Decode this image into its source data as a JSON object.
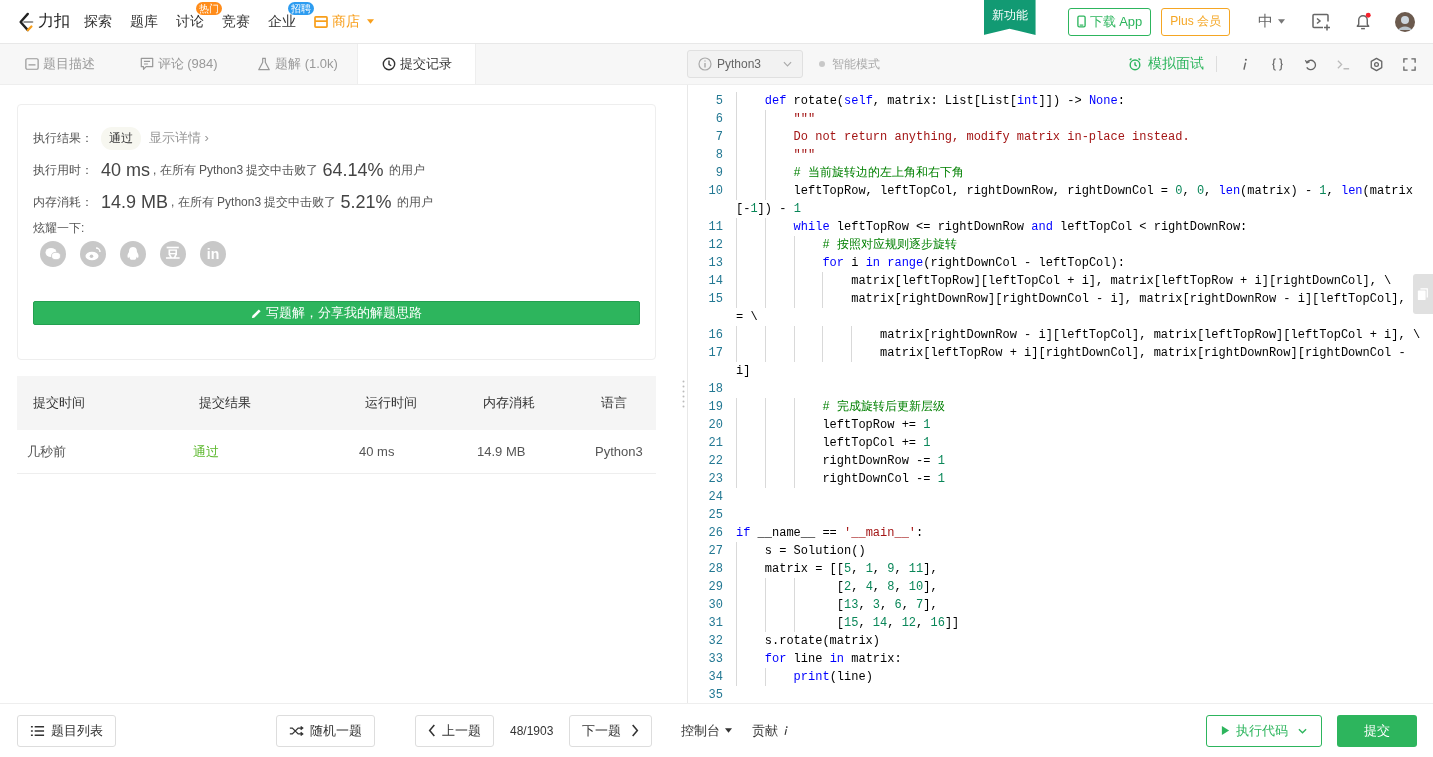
{
  "nav": {
    "brand": "力扣",
    "items": [
      {
        "kind": "link",
        "label": "探索"
      },
      {
        "kind": "link",
        "label": "题库"
      },
      {
        "kind": "link",
        "label": "讨论",
        "badge": {
          "text": "热门",
          "color": "#ff8c1a"
        }
      },
      {
        "kind": "link",
        "label": "竞赛"
      },
      {
        "kind": "link",
        "label": "企业",
        "badge": {
          "text": "招聘",
          "color": "#2d9cf0"
        }
      },
      {
        "kind": "store",
        "label": "商店"
      }
    ],
    "new_feature": "新功能",
    "download": "下载 App",
    "plus": "Plus 会员",
    "language": "中",
    "has_notification": true
  },
  "tabs": [
    {
      "kind": "description",
      "label": "题目描述",
      "selected": false
    },
    {
      "kind": "comments",
      "label": "评论 (984)",
      "selected": false
    },
    {
      "kind": "solutions",
      "label": "题解 (1.0k)",
      "selected": false
    },
    {
      "kind": "submissions",
      "label": "提交记录",
      "selected": true
    }
  ],
  "result": {
    "label": "执行结果：",
    "status": "通过",
    "details_link": "显示详情 ›"
  },
  "stats": [
    {
      "label": "执行用时：",
      "value": "40 ms",
      "text": ", 在所有 Python3 提交中击败了",
      "percent": "64.14%",
      "suffix": "的用户"
    },
    {
      "label": "内存消耗：",
      "value": "14.9 MB",
      "text": ", 在所有 Python3 提交中击败了",
      "percent": "5.21%",
      "suffix": "的用户"
    }
  ],
  "share": {
    "label": "炫耀一下:",
    "items": [
      {
        "kind": "wechat"
      },
      {
        "kind": "weibo"
      },
      {
        "kind": "qq"
      },
      {
        "kind": "glyph",
        "text": "豆"
      },
      {
        "kind": "glyph",
        "text": "in"
      }
    ]
  },
  "write_solution": "写题解，分享我的解题思路",
  "submissions": {
    "columns": [
      "提交时间",
      "提交结果",
      "运行时间",
      "内存消耗",
      "语言"
    ],
    "rows": [
      {
        "time": "几秒前",
        "result": "通过",
        "passed": true,
        "runtime": "40 ms",
        "memory": "14.9 MB",
        "language": "Python3"
      }
    ]
  },
  "editor": {
    "language": "Python3",
    "smart_mode": {
      "label": "智能模式",
      "on": false
    },
    "interview": "模拟面试",
    "lines": [
      {
        "number": "5",
        "tokens": [
          {
            "kind": "keyword",
            "text": "    def"
          },
          {
            "kind": "plain",
            "text": " rotate("
          },
          {
            "kind": "keyword",
            "text": "self"
          },
          {
            "kind": "plain",
            "text": ", matrix: List[List["
          },
          {
            "kind": "keyword",
            "text": "int"
          },
          {
            "kind": "plain",
            "text": "]]) -> "
          },
          {
            "kind": "keyword",
            "text": "None"
          },
          {
            "kind": "plain",
            "text": ":"
          }
        ]
      },
      {
        "number": "6",
        "tokens": [
          {
            "kind": "string",
            "text": "        \"\"\""
          }
        ]
      },
      {
        "number": "7",
        "tokens": [
          {
            "kind": "string",
            "text": "        Do not return anything, modify matrix in-place instead."
          }
        ]
      },
      {
        "number": "8",
        "tokens": [
          {
            "kind": "string",
            "text": "        \"\"\""
          }
        ]
      },
      {
        "number": "9",
        "tokens": [
          {
            "kind": "comment",
            "text": "        # 当前旋转边的左上角和右下角"
          }
        ]
      },
      {
        "number": "10",
        "tokens": [
          {
            "kind": "plain",
            "text": "        leftTopRow, leftTopCol, rightDownRow, rightDownCol = "
          },
          {
            "kind": "number",
            "text": "0"
          },
          {
            "kind": "plain",
            "text": ", "
          },
          {
            "kind": "number",
            "text": "0"
          },
          {
            "kind": "plain",
            "text": ", "
          },
          {
            "kind": "keyword",
            "text": "len"
          },
          {
            "kind": "plain",
            "text": "(matrix) - "
          },
          {
            "kind": "number",
            "text": "1"
          },
          {
            "kind": "plain",
            "text": ", "
          },
          {
            "kind": "keyword",
            "text": "len"
          },
          {
            "kind": "plain",
            "text": "(matrix"
          }
        ],
        "wrap": [
          {
            "kind": "plain",
            "text": "[-"
          },
          {
            "kind": "number",
            "text": "1"
          },
          {
            "kind": "plain",
            "text": "]) - "
          },
          {
            "kind": "number",
            "text": "1"
          }
        ]
      },
      {
        "number": "11",
        "tokens": [
          {
            "kind": "keyword",
            "text": "        while"
          },
          {
            "kind": "plain",
            "text": " leftTopRow <= rightDownRow "
          },
          {
            "kind": "keyword",
            "text": "and"
          },
          {
            "kind": "plain",
            "text": " leftTopCol < rightDownRow:"
          }
        ]
      },
      {
        "number": "12",
        "tokens": [
          {
            "kind": "comment",
            "text": "            # 按照对应规则逐步旋转"
          }
        ]
      },
      {
        "number": "13",
        "tokens": [
          {
            "kind": "keyword",
            "text": "            for"
          },
          {
            "kind": "plain",
            "text": " i "
          },
          {
            "kind": "keyword",
            "text": "in"
          },
          {
            "kind": "keyword",
            "text": " range"
          },
          {
            "kind": "plain",
            "text": "(rightDownCol - leftTopCol):"
          }
        ]
      },
      {
        "number": "14",
        "tokens": [
          {
            "kind": "plain",
            "text": "                matrix[leftTopRow][leftTopCol + i], matrix[leftTopRow + i][rightDownCol], \\"
          }
        ]
      },
      {
        "number": "15",
        "tokens": [
          {
            "kind": "plain",
            "text": "                matrix[rightDownRow][rightDownCol - i], matrix[rightDownRow - i][leftTopCol],"
          }
        ],
        "wrap": [
          {
            "kind": "plain",
            "text": "= \\"
          }
        ]
      },
      {
        "number": "16",
        "tokens": [
          {
            "kind": "plain",
            "text": "                    matrix[rightDownRow - i][leftTopCol], matrix[leftTopRow][leftTopCol + i], \\"
          }
        ]
      },
      {
        "number": "17",
        "tokens": [
          {
            "kind": "plain",
            "text": "                    matrix[leftTopRow + i][rightDownCol], matrix[rightDownRow][rightDownCol -"
          }
        ],
        "wrap": [
          {
            "kind": "plain",
            "text": "i]"
          }
        ]
      },
      {
        "number": "18"
      },
      {
        "number": "19",
        "tokens": [
          {
            "kind": "comment",
            "text": "            # 完成旋转后更新层级"
          }
        ]
      },
      {
        "number": "20",
        "tokens": [
          {
            "kind": "plain",
            "text": "            leftTopRow += "
          },
          {
            "kind": "number",
            "text": "1"
          }
        ]
      },
      {
        "number": "21",
        "tokens": [
          {
            "kind": "plain",
            "text": "            leftTopCol += "
          },
          {
            "kind": "number",
            "text": "1"
          }
        ]
      },
      {
        "number": "22",
        "tokens": [
          {
            "kind": "plain",
            "text": "            rightDownRow -= "
          },
          {
            "kind": "number",
            "text": "1"
          }
        ]
      },
      {
        "number": "23",
        "tokens": [
          {
            "kind": "plain",
            "text": "            rightDownCol -= "
          },
          {
            "kind": "number",
            "text": "1"
          }
        ]
      },
      {
        "number": "24"
      },
      {
        "number": "25"
      },
      {
        "number": "26",
        "tokens": [
          {
            "kind": "keyword",
            "text": "if"
          },
          {
            "kind": "plain",
            "text": " __name__ == "
          },
          {
            "kind": "string",
            "text": "'__main__'"
          },
          {
            "kind": "plain",
            "text": ":"
          }
        ]
      },
      {
        "number": "27",
        "tokens": [
          {
            "kind": "plain",
            "text": "    s = Solution()"
          }
        ]
      },
      {
        "number": "28",
        "tokens": [
          {
            "kind": "plain",
            "text": "    matrix = [["
          },
          {
            "kind": "number",
            "text": "5"
          },
          {
            "kind": "plain",
            "text": ", "
          },
          {
            "kind": "number",
            "text": "1"
          },
          {
            "kind": "plain",
            "text": ", "
          },
          {
            "kind": "number",
            "text": "9"
          },
          {
            "kind": "plain",
            "text": ", "
          },
          {
            "kind": "number",
            "text": "11"
          },
          {
            "kind": "plain",
            "text": "],"
          }
        ]
      },
      {
        "number": "29",
        "tokens": [
          {
            "kind": "plain",
            "text": "              ["
          },
          {
            "kind": "number",
            "text": "2"
          },
          {
            "kind": "plain",
            "text": ", "
          },
          {
            "kind": "number",
            "text": "4"
          },
          {
            "kind": "plain",
            "text": ", "
          },
          {
            "kind": "number",
            "text": "8"
          },
          {
            "kind": "plain",
            "text": ", "
          },
          {
            "kind": "number",
            "text": "10"
          },
          {
            "kind": "plain",
            "text": "],"
          }
        ]
      },
      {
        "number": "30",
        "tokens": [
          {
            "kind": "plain",
            "text": "              ["
          },
          {
            "kind": "number",
            "text": "13"
          },
          {
            "kind": "plain",
            "text": ", "
          },
          {
            "kind": "number",
            "text": "3"
          },
          {
            "kind": "plain",
            "text": ", "
          },
          {
            "kind": "number",
            "text": "6"
          },
          {
            "kind": "plain",
            "text": ", "
          },
          {
            "kind": "number",
            "text": "7"
          },
          {
            "kind": "plain",
            "text": "],"
          }
        ]
      },
      {
        "number": "31",
        "tokens": [
          {
            "kind": "plain",
            "text": "              ["
          },
          {
            "kind": "number",
            "text": "15"
          },
          {
            "kind": "plain",
            "text": ", "
          },
          {
            "kind": "number",
            "text": "14"
          },
          {
            "kind": "plain",
            "text": ", "
          },
          {
            "kind": "number",
            "text": "12"
          },
          {
            "kind": "plain",
            "text": ", "
          },
          {
            "kind": "number",
            "text": "16"
          },
          {
            "kind": "plain",
            "text": "]]"
          }
        ]
      },
      {
        "number": "32",
        "tokens": [
          {
            "kind": "plain",
            "text": "    s.rotate(matrix)"
          }
        ]
      },
      {
        "number": "33",
        "tokens": [
          {
            "kind": "keyword",
            "text": "    for"
          },
          {
            "kind": "plain",
            "text": " line "
          },
          {
            "kind": "keyword",
            "text": "in"
          },
          {
            "kind": "plain",
            "text": " matrix:"
          }
        ]
      },
      {
        "number": "34",
        "tokens": [
          {
            "kind": "keyword",
            "text": "        print"
          },
          {
            "kind": "plain",
            "text": "(line)"
          }
        ]
      },
      {
        "number": "35"
      }
    ]
  },
  "footer": {
    "problem_list": "题目列表",
    "random": "随机一题",
    "prev": "上一题",
    "progress": "48/1903",
    "next": "下一题",
    "console": "控制台",
    "contribute": "贡献",
    "run": "执行代码",
    "submit": "提交"
  }
}
